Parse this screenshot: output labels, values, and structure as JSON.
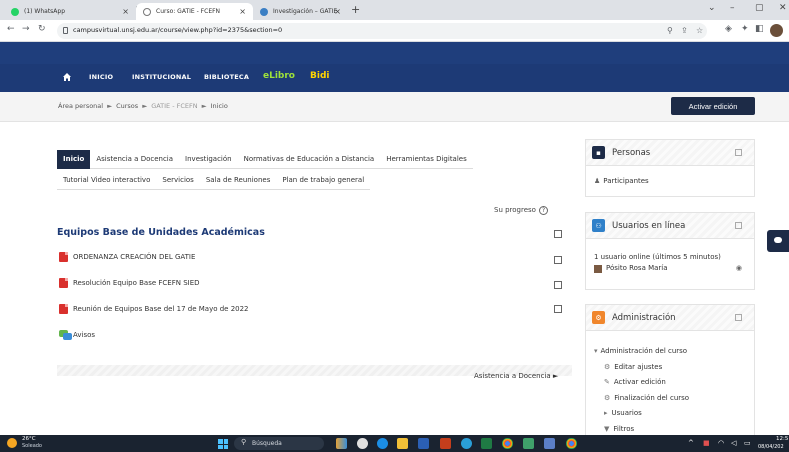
{
  "browser": {
    "tabs": [
      {
        "title": "(1) WhatsApp"
      },
      {
        "title": "Curso: GATIE - FCEFN"
      },
      {
        "title": "Investigación – GATIE"
      }
    ],
    "url": "campusvirtual.unsj.edu.ar/course/view.php?id=2375&section=0",
    "new_tab": "+",
    "close": "×"
  },
  "site_nav": {
    "items": [
      "INICIO",
      "INSTITUCIONAL",
      "BIBLIOTECA"
    ],
    "elibro": "eLibro",
    "bidi": "Bidi"
  },
  "breadcrumb": {
    "items": [
      "Área personal",
      "Cursos",
      "GATIE - FCEFN",
      "Inicio"
    ],
    "separator": "►"
  },
  "edit_button": "Activar edición",
  "course_tabs": {
    "row1": [
      "Inicio",
      "Asistencia a Docencia",
      "Investigación",
      "Normativas de Educación a Distancia",
      "Herramientas Digitales"
    ],
    "row2": [
      "Tutorial Video interactivo",
      "Servicios",
      "Sala de Reuniones",
      "Plan de trabajo general"
    ]
  },
  "progress_label": "Su progreso",
  "section": {
    "title": "Equipos Base de Unidades Académicas",
    "activities": [
      {
        "label": "ORDENANZA CREACIÓN DEL GATIE",
        "icon": "pdf-icon"
      },
      {
        "label": "Resolución Equipo Base FCEFN SIED",
        "icon": "pdf-icon"
      },
      {
        "label": "Reunión de Equipos Base del 17 de Mayo de 2022",
        "icon": "pdf-icon"
      },
      {
        "label": "Avisos",
        "icon": "forum-icon"
      }
    ]
  },
  "next_section": "Asistencia a Docencia ►",
  "blocks": {
    "personas": {
      "title": "Personas",
      "link": "Participantes",
      "color": "#1d2b47"
    },
    "online": {
      "title": "Usuarios en línea",
      "summary": "1 usuario online (últimos 5 minutos)",
      "user": "Pósito Rosa María",
      "color": "#2f80c9"
    },
    "admin": {
      "title": "Administración",
      "color": "#f0862c",
      "section": "Administración del curso",
      "items": [
        "Editar ajustes",
        "Activar edición",
        "Finalización del curso",
        "Usuarios",
        "Filtros"
      ]
    }
  },
  "taskbar": {
    "temp": "26°C",
    "weather": "Soleado",
    "search": "Búsqueda",
    "time": "12:5",
    "date": "08/04/202"
  }
}
